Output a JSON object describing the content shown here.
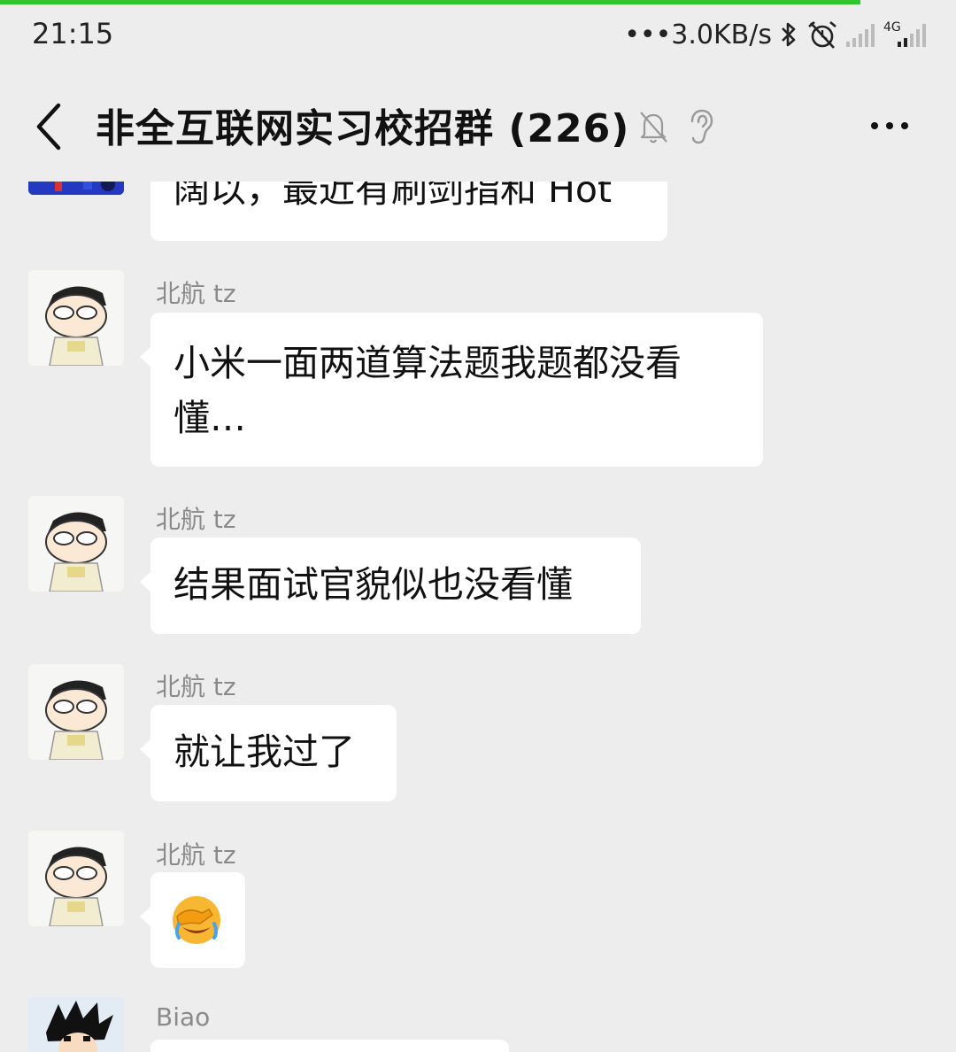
{
  "status_bar": {
    "time": "21:15",
    "net_speed": "•••3.0KB/s",
    "network_type": "4G",
    "icons": [
      "bluetooth-icon",
      "alarm-off-icon",
      "signal-sim1-icon",
      "signal-sim2-icon"
    ]
  },
  "header": {
    "title": "非全互联网实习校招群 (226)",
    "icons": [
      "back-arrow-icon",
      "mute-bell-icon",
      "earpiece-icon",
      "more-dots-icon"
    ]
  },
  "messages": [
    {
      "sender": "",
      "text": "阔以，最近有刷剑指和 Hot",
      "avatar": "blue-avatar"
    },
    {
      "sender": "北航 tz",
      "text_line1": "小米一面两道算法题我题都没看",
      "text_line2": "懂…",
      "avatar": "cartoon-boy-avatar"
    },
    {
      "sender": "北航 tz",
      "text": "结果面试官貌似也没看懂",
      "avatar": "cartoon-boy-avatar"
    },
    {
      "sender": "北航 tz",
      "text": "就让我过了",
      "avatar": "cartoon-boy-avatar"
    },
    {
      "sender": "北航 tz",
      "text": "😭",
      "avatar": "cartoon-boy-avatar",
      "emoji_name": "facepalm-crying-emoji"
    },
    {
      "sender": "Biao",
      "text": "",
      "avatar": "anime-boy-avatar"
    }
  ],
  "colors": {
    "background": "#ededed",
    "bubble": "#ffffff",
    "progress": "#2ec52e",
    "sender": "#8a8a8a"
  }
}
